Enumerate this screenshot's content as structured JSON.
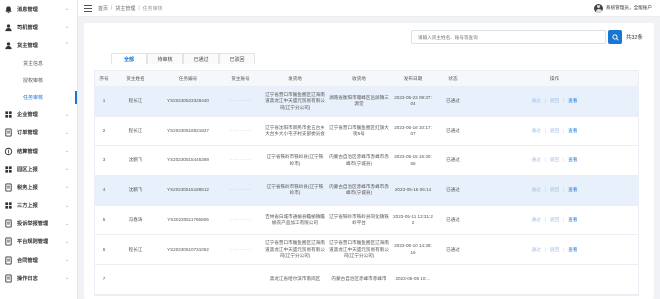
{
  "sidebar": {
    "items": [
      {
        "label": "消息管理",
        "icon": "bell-icon"
      },
      {
        "label": "司机管理",
        "icon": "driver-icon"
      },
      {
        "label": "货主管理",
        "icon": "owner-icon",
        "expanded": true,
        "children": [
          {
            "label": "货主信息"
          },
          {
            "label": "授权审核"
          },
          {
            "label": "任务审核",
            "active": true
          }
        ]
      },
      {
        "label": "企业管理",
        "icon": "building-icon"
      },
      {
        "label": "订单管理",
        "icon": "order-icon"
      },
      {
        "label": "结算管理",
        "icon": "settle-icon"
      },
      {
        "label": "园区上报",
        "icon": "park-icon"
      },
      {
        "label": "税务上报",
        "icon": "tax-icon"
      },
      {
        "label": "三方上报",
        "icon": "thirdparty-icon"
      },
      {
        "label": "投诉举报管理",
        "icon": "complaint-icon"
      },
      {
        "label": "平台规则管理",
        "icon": "rules-icon"
      },
      {
        "label": "合同管理",
        "icon": "contract-icon"
      },
      {
        "label": "操作日志",
        "icon": "log-icon"
      }
    ]
  },
  "topbar": {
    "breadcrumb": [
      "首页",
      "货主管理",
      "任务审核"
    ],
    "user": "系统管理员，全能账户"
  },
  "search": {
    "placeholder": "请输入货主姓名、账号等查询",
    "total": "共32条"
  },
  "tabs": [
    "全部",
    "待审核",
    "已通过",
    "已驳回"
  ],
  "table": {
    "headers": [
      "序号",
      "货主姓名",
      "任务编号",
      "货主账号",
      "发货地",
      "收货地",
      "发布日期",
      "状态",
      "操作"
    ],
    "actions": [
      "通过",
      "驳回",
      "查看"
    ],
    "rows": [
      {
        "no": "1",
        "name": "程长江",
        "task_no": "YS20230523328440",
        "account": "·············",
        "from": "辽宁省营口市鲅鱼圈区辽海南道黑龙江中天盛元贸易有限公司(辽宁分公司)",
        "to": "湖南省衡阳市雁峰区岳屏镇三源堂",
        "date": "2023-05-23 09:37:04",
        "status": "已通过"
      },
      {
        "no": "2",
        "name": "程长江",
        "task_no": "YS20230516921827",
        "account": "·············",
        "from": "辽宁省沈阳市新民市金五台乡大台乡大小屯子村支部委员会",
        "to": "辽宁省营口市鲅鱼圈区红旗大街5号",
        "date": "2023-05-16 10:17:07",
        "status": "已通过"
      },
      {
        "no": "3",
        "name": "沈鹏飞",
        "task_no": "YS20230515445369",
        "account": "·············",
        "from": "辽宁省铁岭市铁岭县(辽宁铁岭市)",
        "to": "内蒙古自治区赤峰市赤峰市赤峰市(宁城县)",
        "date": "2023-05-15 15:30:55",
        "status": "已通过"
      },
      {
        "no": "4",
        "name": "沈鹏飞",
        "task_no": "YS20230515188512",
        "account": "·············",
        "from": "辽宁省铁岭市铁岭县(辽宁铁岭市)",
        "to": "内蒙古自治区赤峰市赤峰市赤峰市(宁城县)",
        "date": "2023-05-15 06:14",
        "status": "已通过"
      },
      {
        "no": "5",
        "name": "冯春涛",
        "task_no": "YS20230511765506",
        "account": "·············",
        "from": "吉林省白城市通榆县瞻榆镇瞻榆农产品加工有限公司",
        "to": "辽宁省铁岭市铁岭县同化镇铁岭平台",
        "date": "2023-05-11 13:31:22",
        "status": "已通过"
      },
      {
        "no": "6",
        "name": "程长江",
        "task_no": "YS20230510731062",
        "account": "·············",
        "from": "辽宁省营口市鲅鱼圈区辽海南道黑龙江中天盛元贸易有限公司(辽宁分公司)",
        "to": "辽宁省营口市鲅鱼圈区辽海南道黑龙江中天盛元贸易有限公司(辽宁分公司)",
        "date": "2023-05-10 14:39:16",
        "status": "已通过"
      },
      {
        "no": "7",
        "name": "",
        "task_no": "",
        "account": "",
        "from": "黑龙江省哈尔滨市南岗区",
        "to": "内蒙古自治区赤峰市赤峰市",
        "date": "2023-05-08 10:...",
        "status": ""
      }
    ]
  }
}
